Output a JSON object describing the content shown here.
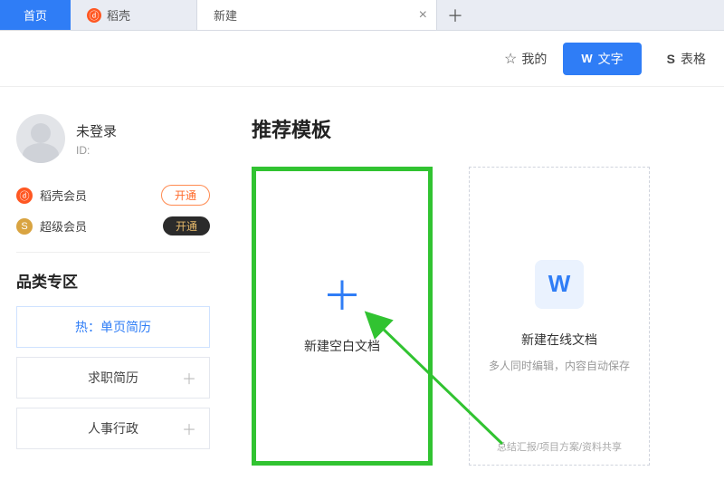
{
  "tabs": {
    "home": "首页",
    "docer": "稻壳",
    "new": "新建"
  },
  "toolbar": {
    "mydocs": "我的",
    "text_btn": "文字",
    "sheet_btn": "表格"
  },
  "user": {
    "name": "未登录",
    "id_label": "ID:"
  },
  "membership": {
    "docer_label": "稻壳会员",
    "super_label": "超级会员",
    "open_btn": "开通"
  },
  "categories": {
    "title": "品类专区",
    "hot": "热：单页简历",
    "resume": "求职简历",
    "hr": "人事行政"
  },
  "recommend": {
    "title": "推荐模板",
    "blank_label": "新建空白文档",
    "online_label": "新建在线文档",
    "online_sub1": "多人同时编辑，内容自动保存",
    "online_footer": "总结汇报/项目方案/资料共享"
  }
}
